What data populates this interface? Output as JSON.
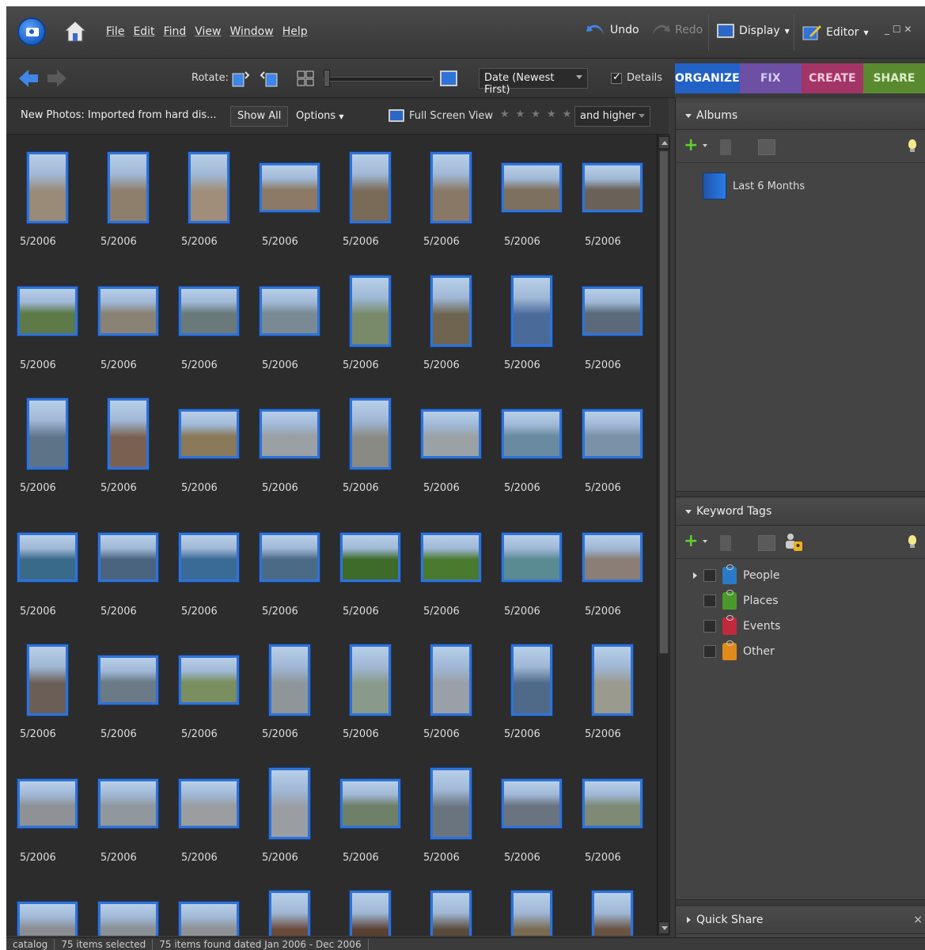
{
  "menubar": {
    "menus": [
      "File",
      "Edit",
      "Find",
      "View",
      "Window",
      "Help"
    ],
    "undo": "Undo",
    "redo": "Redo",
    "display": "Display",
    "editor": "Editor",
    "window_controls": "_ ☐ ✕"
  },
  "toolbar": {
    "rotate_label": "Rotate:",
    "sort_value": "Date (Newest First)",
    "details_label": "Details",
    "details_checked": true
  },
  "tabs": [
    "ORGANIZE",
    "FIX",
    "CREATE",
    "SHARE"
  ],
  "filterbar": {
    "title": "New Photos: Imported from hard dis...",
    "show_all": "Show All",
    "options": "Options",
    "full_screen": "Full Screen View",
    "stars": "★★★★★",
    "rating_value": "and higher"
  },
  "grid": {
    "date_label": "5/2006",
    "rows": [
      [
        "p",
        "p",
        "p",
        "l",
        "p",
        "p",
        "l",
        "l"
      ],
      [
        "l",
        "l",
        "l",
        "l",
        "p",
        "p",
        "p",
        "l"
      ],
      [
        "p",
        "p",
        "l",
        "l",
        "p",
        "l",
        "l",
        "l"
      ],
      [
        "l",
        "l",
        "l",
        "l",
        "l",
        "l",
        "l",
        "l"
      ],
      [
        "p",
        "l",
        "l",
        "p",
        "p",
        "p",
        "p",
        "p"
      ],
      [
        "l",
        "l",
        "l",
        "p",
        "l",
        "p",
        "l",
        "l"
      ],
      [
        "l",
        "l",
        "l",
        "p",
        "p",
        "p",
        "p",
        "p"
      ]
    ],
    "colors": [
      [
        "#9a8a78",
        "#8e7e6c",
        "#a08e7a",
        "#8c7a66",
        "#7a6a58",
        "#8a7866",
        "#7e705e",
        "#6a6258"
      ],
      [
        "#5d7a48",
        "#8a8274",
        "#6a7a7a",
        "#7a8a94",
        "#788a6a",
        "#6e6450",
        "#4a6a9a",
        "#5a6a7a"
      ],
      [
        "#5d7488",
        "#7a6050",
        "#8a7a5a",
        "#9aa0a4",
        "#8a8a84",
        "#9aa2a6",
        "#6a8aa0",
        "#7a92a8"
      ],
      [
        "#3a6a8a",
        "#4a6480",
        "#3a6a96",
        "#4a6a86",
        "#3e6a2a",
        "#4a7a2e",
        "#5a8a92",
        "#8a7e76"
      ],
      [
        "#6a5e56",
        "#6a7a86",
        "#7a8e60",
        "#8e969a",
        "#8a9a8a",
        "#9aa0a8",
        "#4e6a88",
        "#9a9a8e"
      ],
      [
        "#8e9296",
        "#90989e",
        "#9a9ea0",
        "#9a9ea2",
        "#6e8068",
        "#6a747e",
        "#6a7480",
        "#7e8a74"
      ],
      [
        "#8a8e92",
        "#8a9096",
        "#8e9296",
        "#6a4a38",
        "#5a4030",
        "#5a4a3a",
        "#7a6a50",
        "#6a5240"
      ]
    ]
  },
  "panel": {
    "albums_title": "Albums",
    "album_item": "Last 6 Months",
    "keyword_title": "Keyword Tags",
    "tags": [
      {
        "label": "People",
        "color": "#2a7ac8"
      },
      {
        "label": "Places",
        "color": "#4a9a2a"
      },
      {
        "label": "Events",
        "color": "#c02a3a"
      },
      {
        "label": "Other",
        "color": "#e08a1a"
      }
    ],
    "quick_share": "Quick Share",
    "quick_share_close": "×"
  },
  "statusbar": {
    "catalog": "catalog",
    "selected": "75 items selected",
    "found": "75 items found dated Jan 2006 - Dec 2006"
  }
}
